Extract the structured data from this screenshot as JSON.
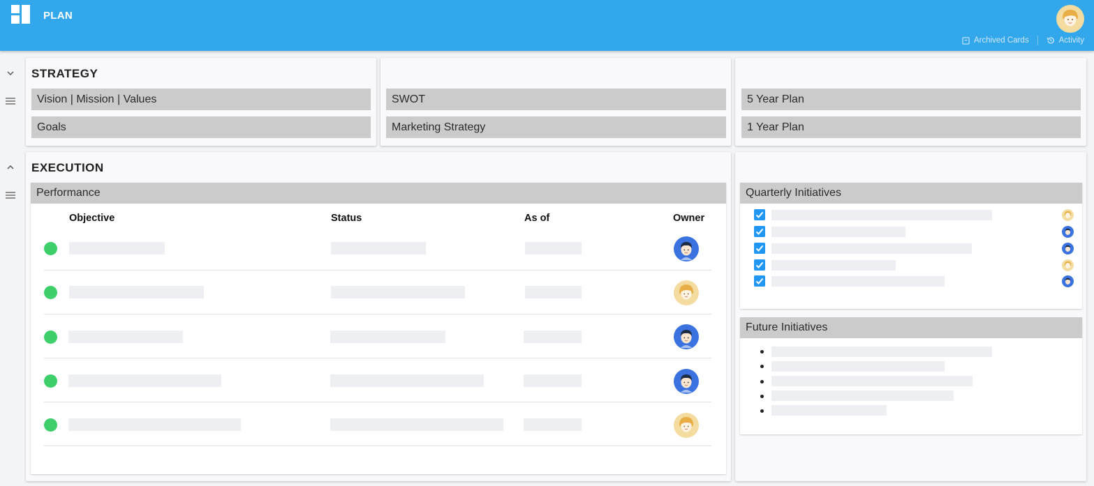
{
  "header": {
    "title": "PLAN",
    "links": [
      {
        "label": "Archived Cards",
        "icon": "archive-icon"
      },
      {
        "label": "Activity",
        "icon": "history-icon"
      }
    ]
  },
  "strategy": {
    "title": "STRATEGY",
    "cards": [
      "Vision | Mission | Values",
      "Goals",
      "SWOT",
      "Marketing Strategy",
      "5 Year Plan",
      "1 Year Plan"
    ]
  },
  "execution": {
    "title": "EXECUTION",
    "performance": {
      "title": "Performance",
      "columns": [
        "Objective",
        "Status",
        "As of",
        "Owner"
      ],
      "rows": [
        {
          "status_color": "#3ecf6a",
          "owner": "male"
        },
        {
          "status_color": "#3ecf6a",
          "owner": "female"
        },
        {
          "status_color": "#3ecf6a",
          "owner": "male"
        },
        {
          "status_color": "#3ecf6a",
          "owner": "male"
        },
        {
          "status_color": "#3ecf6a",
          "owner": "female"
        }
      ]
    },
    "quarterly": {
      "title": "Quarterly Initiatives",
      "items": [
        {
          "checked": true,
          "owner": "female"
        },
        {
          "checked": true,
          "owner": "male"
        },
        {
          "checked": true,
          "owner": "male"
        },
        {
          "checked": true,
          "owner": "female"
        },
        {
          "checked": true,
          "owner": "male"
        }
      ]
    },
    "future": {
      "title": "Future Initiatives",
      "item_count": 5
    }
  },
  "colors": {
    "header": "#33a7ec",
    "accent": "#2196f3",
    "status_green": "#3ecf6a",
    "card_gray": "#cbcbcc"
  }
}
